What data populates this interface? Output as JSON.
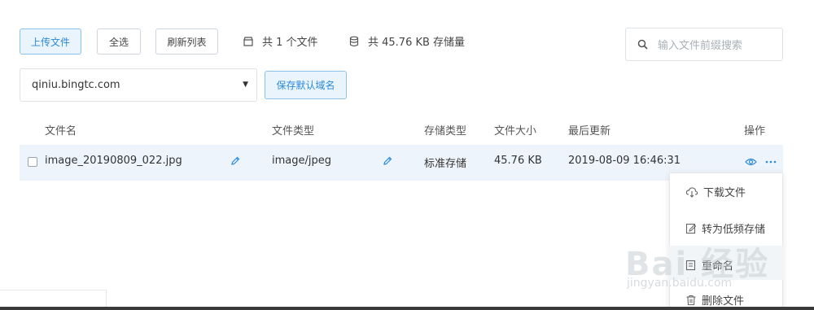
{
  "toolbar": {
    "upload_label": "上传文件",
    "select_all_label": "全选",
    "refresh_label": "刷新列表",
    "file_count": "共 1 个文件",
    "storage_total": "共 45.76 KB 存储量"
  },
  "search": {
    "placeholder": "输入文件前缀搜索"
  },
  "domain": {
    "selected": "qiniu.bingtc.com",
    "save_default_label": "保存默认域名"
  },
  "table": {
    "headers": {
      "name": "文件名",
      "type": "文件类型",
      "storage": "存储类型",
      "size": "文件大小",
      "updated": "最后更新",
      "actions": "操作"
    },
    "rows": [
      {
        "name": "image_20190809_022.jpg",
        "type": "image/jpeg",
        "storage": "标准存储",
        "size": "45.76 KB",
        "updated": "2019-08-09 16:46:31"
      }
    ]
  },
  "menu": {
    "download": "下载文件",
    "to_low_freq": "转为低频存储",
    "rename": "重命名",
    "delete": "删除文件"
  },
  "watermark": {
    "main": "Bai 经验",
    "sub": "jingyan.baidu.com"
  },
  "colors": {
    "accent": "#2b8ad8",
    "row_bg": "#eef4fb"
  },
  "icons": [
    "box-icon",
    "database-icon",
    "search-icon",
    "pencil-icon",
    "eye-icon",
    "more-icon",
    "cloud-download-icon",
    "edit-doc-icon",
    "trash-icon"
  ]
}
